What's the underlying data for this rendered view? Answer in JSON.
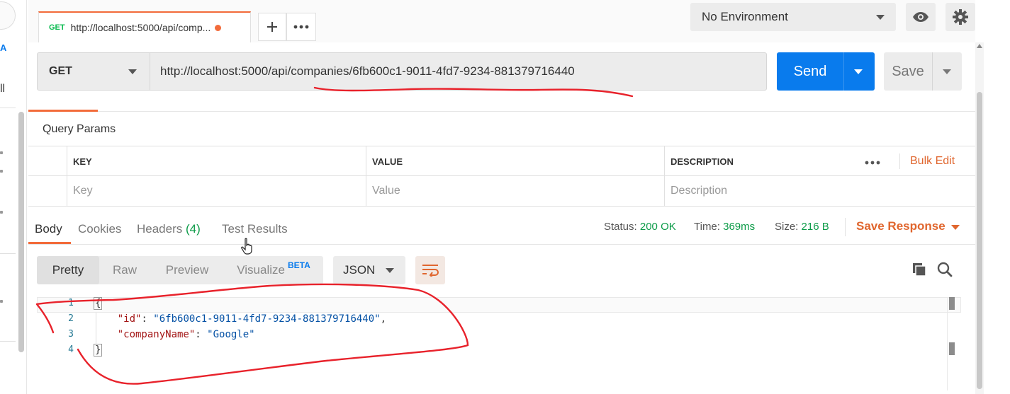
{
  "tab": {
    "method": "GET",
    "title": "http://localhost:5000/api/comp..."
  },
  "environment": {
    "selected": "No Environment"
  },
  "sidebar": {
    "partial_label": "A",
    "partial_text": "ll"
  },
  "request": {
    "method": "GET",
    "url": "http://localhost:5000/api/companies/6fb600c1-9011-4fd7-9234-881379716440",
    "send_label": "Send",
    "save_label": "Save"
  },
  "query_params": {
    "title": "Query Params",
    "columns": [
      "KEY",
      "VALUE",
      "DESCRIPTION"
    ],
    "placeholders": [
      "Key",
      "Value",
      "Description"
    ],
    "bulk_edit_label": "Bulk Edit"
  },
  "response": {
    "tabs": [
      {
        "label": "Body"
      },
      {
        "label": "Cookies"
      },
      {
        "label": "Headers",
        "count": "(4)"
      },
      {
        "label": "Test Results"
      }
    ],
    "status_label": "Status:",
    "status_value": "200 OK",
    "time_label": "Time:",
    "time_value": "369ms",
    "size_label": "Size:",
    "size_value": "216 B",
    "save_response_label": "Save Response",
    "view_modes": [
      "Pretty",
      "Raw",
      "Preview",
      "Visualize"
    ],
    "beta_badge": "BETA",
    "format": "JSON",
    "body_lines": {
      "l1": "{",
      "id_key": "\"id\"",
      "id_value": "\"6fb600c1-9011-4fd7-9234-881379716440\"",
      "name_key": "\"companyName\"",
      "name_value": "\"Google\"",
      "l4": "}"
    },
    "line_numbers": [
      "1",
      "2",
      "3",
      "4"
    ]
  },
  "colors": {
    "accent": "#f26b3a",
    "send_blue": "#097bed",
    "status_green": "#0c9b48",
    "annotation_red": "#e8222b"
  },
  "icons": [
    "plus-icon",
    "more-icon",
    "eye-icon",
    "gear-icon",
    "wrap-lines-icon",
    "copy-icon",
    "search-icon",
    "hand-cursor-icon"
  ]
}
